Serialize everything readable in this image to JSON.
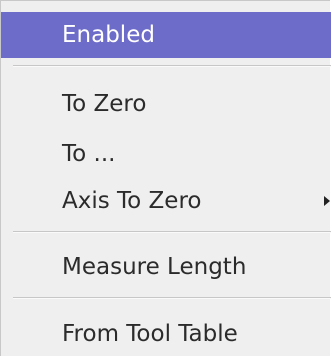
{
  "menu": {
    "items": [
      {
        "label": "Enabled",
        "highlighted": true
      },
      {
        "label": "To Zero"
      },
      {
        "label": "To ..."
      },
      {
        "label": "Axis To Zero",
        "submenu": true,
        "submenu_icon": "triangle-right-icon"
      },
      {
        "label": "Measure Length"
      },
      {
        "label": "From Tool Table"
      }
    ],
    "highlight_color": "#6e6cc9",
    "background_color": "#efefef"
  }
}
